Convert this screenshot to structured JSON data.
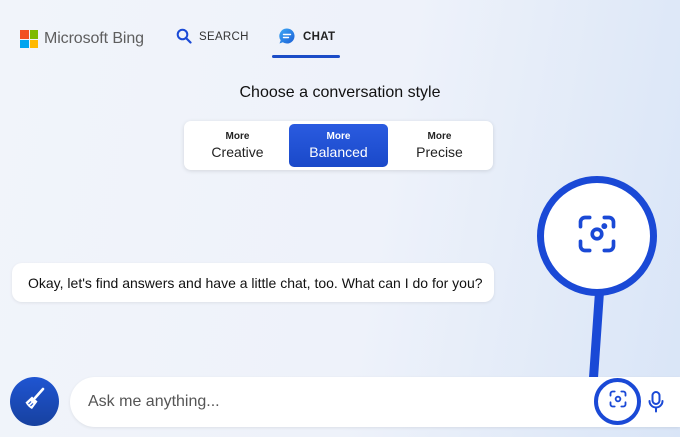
{
  "brand": {
    "name": "Microsoft Bing",
    "logo_colors": [
      "#f25022",
      "#7fba00",
      "#00a4ef",
      "#ffb900"
    ]
  },
  "tabs": [
    {
      "label": "SEARCH",
      "icon": "search-icon",
      "active": false
    },
    {
      "label": "CHAT",
      "icon": "chat-icon",
      "active": true
    }
  ],
  "conversation_style": {
    "title": "Choose a conversation style",
    "options": [
      {
        "small": "More",
        "big": "Creative",
        "selected": false
      },
      {
        "small": "More",
        "big": "Balanced",
        "selected": true
      },
      {
        "small": "More",
        "big": "Precise",
        "selected": false
      }
    ]
  },
  "message": {
    "text": "Okay, let's find answers and have a little chat, too. What can I do for you?"
  },
  "input": {
    "placeholder": "Ask me anything...",
    "value": ""
  },
  "icons": {
    "new_topic": "broom-icon",
    "visual_search": "camera-scan-icon",
    "voice": "microphone-icon"
  },
  "colors": {
    "accent": "#1a49d6",
    "active_style": "#2a5be0"
  }
}
